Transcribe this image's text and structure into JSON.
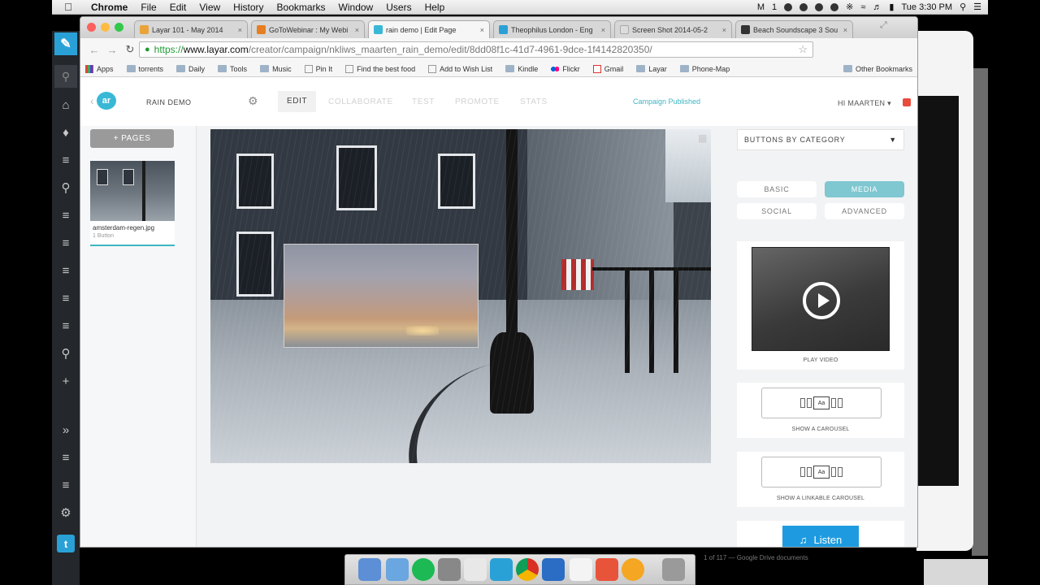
{
  "menubar": {
    "app_name": "Chrome",
    "items": [
      "File",
      "Edit",
      "View",
      "History",
      "Bookmarks",
      "Window",
      "Users",
      "Help"
    ],
    "battery_label": "1",
    "clock": "Tue 3:30 PM"
  },
  "browser": {
    "tabs": [
      {
        "title": "Layar 101 - May 2014",
        "color": "#e9a33a"
      },
      {
        "title": "GoToWebinar : My Webi",
        "color": "#e67e22"
      },
      {
        "title": "rain demo | Edit Page",
        "color": "#39b8d6",
        "active": true
      },
      {
        "title": "Theophilus London - Eng",
        "color": "#2aa1d6"
      },
      {
        "title": "Screen Shot 2014-05-2",
        "color": "#dddddd"
      },
      {
        "title": "Beach Soundscape 3 Sou",
        "color": "#333333"
      }
    ],
    "url": {
      "protocol": "https://",
      "host": "www.layar.com",
      "path": "/creator/campaign/nkliws_maarten_rain_demo/edit/8dd08f1c-41d7-4961-9dce-1f4142820350/"
    },
    "bookmarks": [
      {
        "label": "Apps",
        "kind": "apps"
      },
      {
        "label": "torrents",
        "kind": "folder"
      },
      {
        "label": "Daily",
        "kind": "folder"
      },
      {
        "label": "Tools",
        "kind": "folder"
      },
      {
        "label": "Music",
        "kind": "folder"
      },
      {
        "label": "Pin It",
        "kind": "pin"
      },
      {
        "label": "Find the best food",
        "kind": "link"
      },
      {
        "label": "Add to Wish List",
        "kind": "link"
      },
      {
        "label": "Kindle",
        "kind": "folder"
      },
      {
        "label": "Flickr",
        "kind": "flickr"
      },
      {
        "label": "Gmail",
        "kind": "gmail"
      },
      {
        "label": "Layar",
        "kind": "folder"
      },
      {
        "label": "Phone-Map",
        "kind": "folder"
      }
    ],
    "other_bookmarks": "Other Bookmarks"
  },
  "app": {
    "campaign_name": "RAIN DEMO",
    "logo_text": "ar",
    "nav": [
      "EDIT",
      "COLLABORATE",
      "TEST",
      "PROMOTE",
      "STATS"
    ],
    "active_nav": "EDIT",
    "status": "Campaign Published",
    "user": "HI MAARTEN",
    "add_pages": "+ PAGES",
    "page": {
      "filename": "amsterdam-regen.jpg",
      "subtitle": "1 Button"
    },
    "panel": {
      "category_select": "BUTTONS BY CATEGORY",
      "categories": [
        "BASIC",
        "MEDIA",
        "SOCIAL",
        "ADVANCED"
      ],
      "active_category": "MEDIA",
      "buttons": [
        {
          "label": "PLAY VIDEO"
        },
        {
          "label": "SHOW A CAROUSEL"
        },
        {
          "label": "SHOW A LINKABLE CAROUSEL"
        }
      ],
      "listen_label": "Listen"
    }
  },
  "sidebar_icons": [
    "compose-icon",
    "search-icon",
    "home-icon",
    "notifications-icon",
    "column-icon",
    "search-icon",
    "column-icon",
    "column-icon",
    "column-icon",
    "column-icon",
    "column-icon",
    "search-icon",
    "add-icon",
    "expand-icon",
    "column-icon",
    "column-icon",
    "settings-icon",
    "twitter-icon"
  ],
  "footer_text": "1 of 117 — Google Drive documents"
}
